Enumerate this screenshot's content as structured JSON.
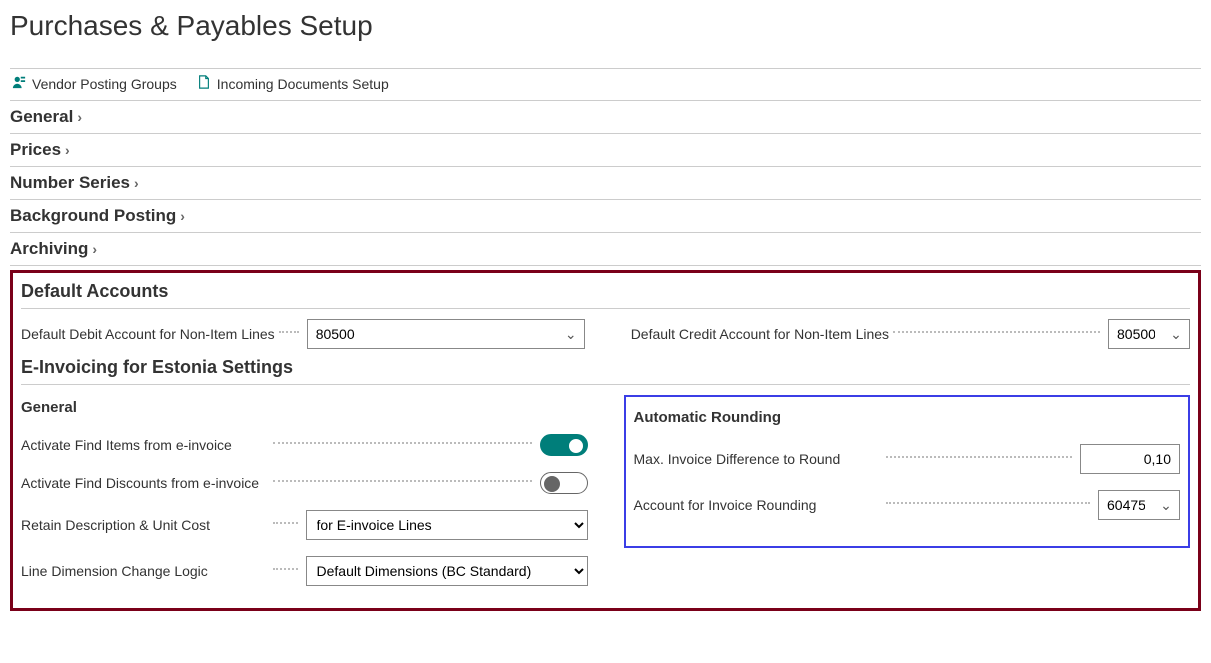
{
  "page": {
    "title": "Purchases & Payables Setup"
  },
  "actions": {
    "vendor_posting_groups": "Vendor Posting Groups",
    "incoming_documents_setup": "Incoming Documents Setup"
  },
  "fasttabs": {
    "general": "General",
    "prices": "Prices",
    "number_series": "Number Series",
    "background_posting": "Background Posting",
    "archiving": "Archiving"
  },
  "default_accounts": {
    "title": "Default Accounts",
    "debit_label": "Default Debit Account for Non-Item Lines",
    "debit_value": "80500",
    "credit_label": "Default Credit Account for Non-Item Lines",
    "credit_value": "80500"
  },
  "einv": {
    "title": "E-Invoicing for Estonia Settings",
    "general_header": "General",
    "activate_find_items_label": "Activate Find Items from e-invoice",
    "activate_find_items_value": true,
    "activate_find_discounts_label": "Activate Find Discounts from e-invoice",
    "activate_find_discounts_value": false,
    "retain_label": "Retain Description & Unit Cost",
    "retain_value": "for E-invoice Lines",
    "line_dim_label": "Line Dimension Change Logic",
    "line_dim_value": "Default Dimensions (BC Standard)",
    "auto_rounding_header": "Automatic Rounding",
    "max_diff_label": "Max. Invoice Difference to Round",
    "max_diff_value": "0,10",
    "account_rounding_label": "Account for Invoice Rounding",
    "account_rounding_value": "60475"
  }
}
